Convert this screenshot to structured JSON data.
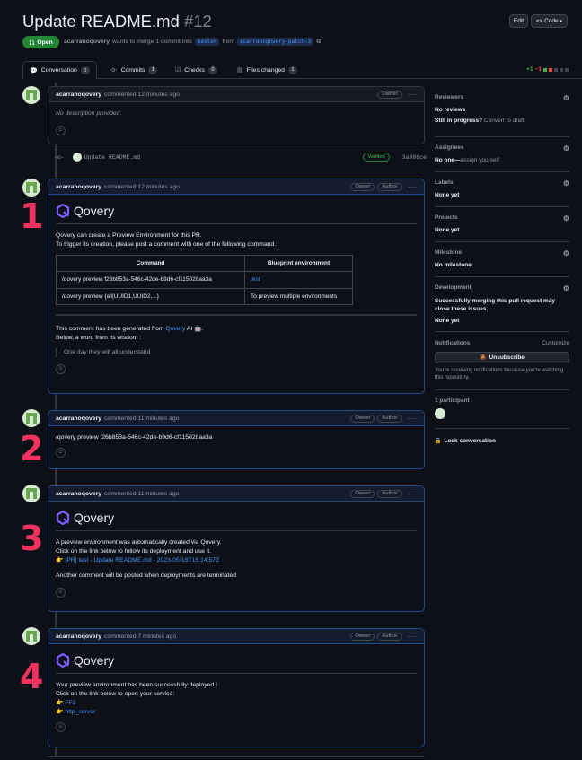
{
  "header": {
    "title": "Update README.md",
    "number": "#12",
    "edit_label": "Edit",
    "code_label": "Code",
    "state_label": "Open",
    "author": "acarranoqovery",
    "meta_text": "wants to merge 1 commit into",
    "base_branch": "master",
    "from_text": "from",
    "head_branch": "acarranoqovery-patch-3"
  },
  "tabs": [
    {
      "label": "Conversation",
      "count": "0"
    },
    {
      "label": "Commits",
      "count": "1"
    },
    {
      "label": "Checks",
      "count": "0"
    },
    {
      "label": "Files changed",
      "count": "1"
    }
  ],
  "diffstat": {
    "added": "+1",
    "removed": "−1"
  },
  "first_comment": {
    "author": "acarranoqovery",
    "time": "commented 12 minutes ago",
    "badge": "Owner",
    "body": "No description provided."
  },
  "commit": {
    "message": "Update README.md",
    "verified": "Verified",
    "sha": "3a006ce"
  },
  "comments": [
    {
      "author": "acarranoqovery",
      "time": "commented 12 minutes ago",
      "badges": [
        "Owner",
        "Author"
      ],
      "logo": "Qovery",
      "line1": "Qovery can create a Preview Environment for this PR.",
      "line2": "To trigger its creation, please post a comment with one of the following command.",
      "table": {
        "headers": [
          "Command",
          "Blueprint environment"
        ],
        "rows": [
          [
            "/qovery preview f26b853a-546c-42de-b9d6-cf115028aa3a",
            "test"
          ],
          [
            "/qovery preview {all|UUID1,UUID2,...}",
            "To preview multiple environments"
          ]
        ]
      },
      "footer1_pre": "This comment has been generated from",
      "footer1_link": "Qovery",
      "footer1_post": "AI 🤖.",
      "footer2": "Below, a word from its wisdom :",
      "quote": "One day they will all understand"
    },
    {
      "author": "acarranoqovery",
      "time": "commented 11 minutes ago",
      "badges": [
        "Owner",
        "Author"
      ],
      "body": "/qovery preview f26b853a-546c-42de-b9d6-cf115028aa3a"
    },
    {
      "author": "acarranoqovery",
      "time": "commented 11 minutes ago",
      "badges": [
        "Owner",
        "Author"
      ],
      "logo": "Qovery",
      "line1": "A preview environment was automatically created via Qovery.",
      "line2": "Click on the link below to follow its deployment and use it.",
      "link": "👉 [PR] test - Update README.md - 2023-05-16T15:14:57Z",
      "line3": "Another comment will be posted when deployments are terminated"
    },
    {
      "author": "acarranoqovery",
      "time": "commented 7 minutes ago",
      "badges": [
        "Owner",
        "Author"
      ],
      "logo": "Qovery",
      "line1": "Your preview environment has been successfully deployed !",
      "line2": "Click on the link below to open your service:",
      "link1": "👉 FF2",
      "link2": "👉 http_server"
    }
  ],
  "annotations": [
    "1",
    "2",
    "3",
    "4"
  ],
  "sidebar": {
    "reviewers_h": "Reviewers",
    "reviewers_v": "No reviews",
    "in_progress": "Still in progress?",
    "convert": "Convert to draft",
    "assignees_h": "Assignees",
    "assignees_v": "No one—",
    "assign_self": "assign yourself",
    "labels_h": "Labels",
    "labels_v": "None yet",
    "projects_h": "Projects",
    "projects_v": "None yet",
    "milestone_h": "Milestone",
    "milestone_v": "No milestone",
    "development_h": "Development",
    "development_text": "Successfully merging this pull request may close these issues.",
    "development_v": "None yet",
    "notifications_h": "Notifications",
    "customize": "Customize",
    "unsubscribe": "Unsubscribe",
    "notif_text": "You're receiving notifications because you're watching this repository.",
    "participants_h": "1 participant",
    "lock": "Lock conversation"
  },
  "colors": {
    "accent": "#4493f8",
    "open": "#238636",
    "annotation": "#f0325e",
    "border_blue": "#1f4a8a"
  }
}
